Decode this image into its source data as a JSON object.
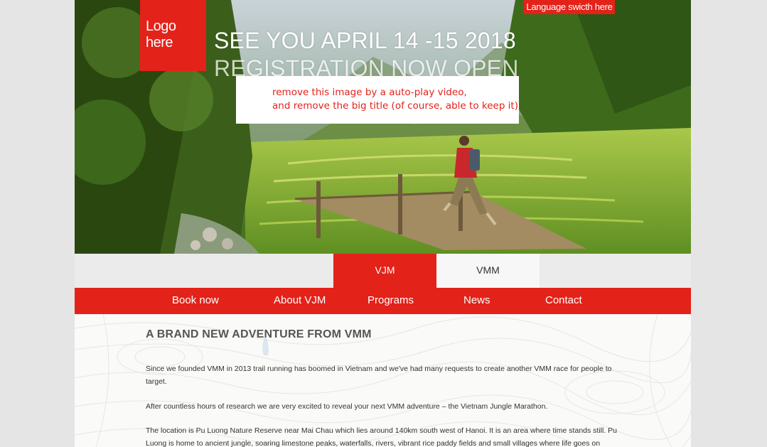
{
  "header": {
    "logo_text": "Logo here",
    "language_switch": "Language swicth here",
    "hero_title_line1": "SEE YOU APRIL 14 -15 2018",
    "hero_title_line2": "REGISTRATION NOW OPEN",
    "note_line1": "remove this image by a auto-play video,",
    "note_line2": "and remove the big title (of course, able to keep it)"
  },
  "tabs": [
    {
      "label": "VJM",
      "active": true
    },
    {
      "label": "VMM",
      "active": false
    }
  ],
  "nav": {
    "items": [
      "Book now",
      "About VJM",
      "Programs",
      "News",
      "Contact"
    ]
  },
  "content": {
    "heading": "A BRAND NEW ADVENTURE FROM VMM",
    "paragraphs": [
      "Since we founded VMM in 2013 trail running has boomed in Vietnam and we've had many requests to create another VMM race for people to target.",
      "After countless hours of research we are very excited to reveal your next VMM adventure – the Vietnam Jungle Marathon.",
      "The location is Pu Luong Nature Reserve near Mai Chau which lies around 140km south west of Hanoi. It is an area where time stands still. Pu Luong is home to ancient jungle, soaring limestone peaks, waterfalls, rivers, vibrant rice paddy fields and small villages where life goes on"
    ]
  },
  "colors": {
    "brand_red": "#e32219",
    "page_bg": "#e5e5e5"
  }
}
